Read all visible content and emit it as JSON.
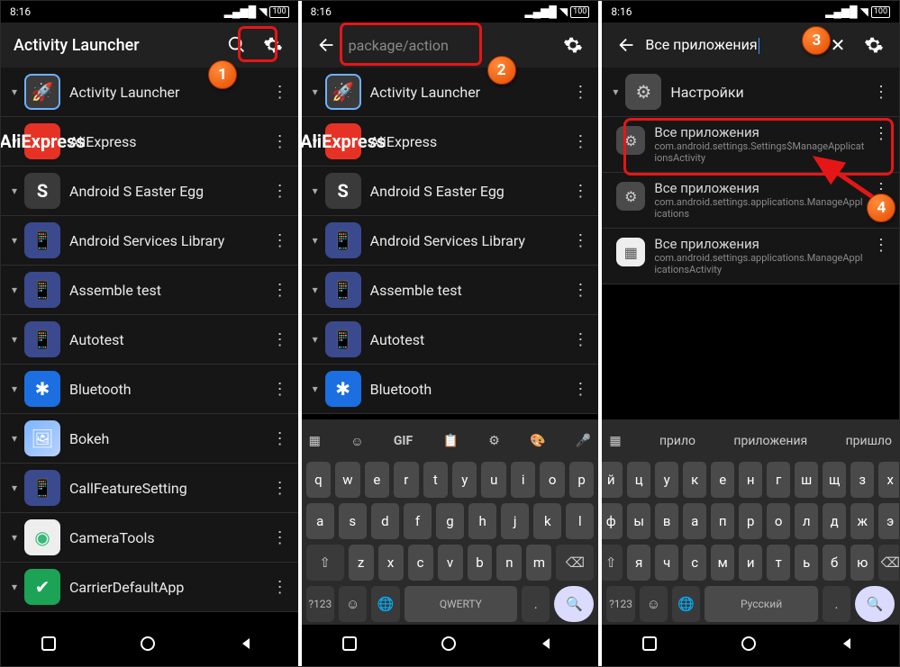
{
  "status": {
    "time": "8:16",
    "battery": "100"
  },
  "panel1": {
    "title": "Activity Launcher",
    "apps": [
      {
        "label": "Activity Launcher",
        "ic": "ic-rocket",
        "glyph": "🚀"
      },
      {
        "label": "AliExpress",
        "ic": "ic-ali",
        "glyph": "AliExpress"
      },
      {
        "label": "Android S Easter Egg",
        "ic": "ic-s",
        "glyph": "S"
      },
      {
        "label": "Android Services Library",
        "ic": "ic-and",
        "glyph": "📱"
      },
      {
        "label": "Assemble test",
        "ic": "ic-and",
        "glyph": "📱"
      },
      {
        "label": "Autotest",
        "ic": "ic-and",
        "glyph": "📱"
      },
      {
        "label": "Bluetooth",
        "ic": "ic-bt",
        "glyph": "✱"
      },
      {
        "label": "Bokeh",
        "ic": "ic-bokeh",
        "glyph": "🖼"
      },
      {
        "label": "CallFeatureSetting",
        "ic": "ic-and",
        "glyph": "📱"
      },
      {
        "label": "CameraTools",
        "ic": "ic-cam",
        "glyph": "◉"
      },
      {
        "label": "CarrierDefaultApp",
        "ic": "ic-car",
        "glyph": "✔"
      }
    ]
  },
  "panel2": {
    "placeholder": "package/action",
    "apps": [
      {
        "label": "Activity Launcher",
        "ic": "ic-rocket",
        "glyph": "🚀"
      },
      {
        "label": "AliExpress",
        "ic": "ic-ali",
        "glyph": "AliExpress"
      },
      {
        "label": "Android S Easter Egg",
        "ic": "ic-s",
        "glyph": "S"
      },
      {
        "label": "Android Services Library",
        "ic": "ic-and",
        "glyph": "📱"
      },
      {
        "label": "Assemble test",
        "ic": "ic-and",
        "glyph": "📱"
      },
      {
        "label": "Autotest",
        "ic": "ic-and",
        "glyph": "📱"
      },
      {
        "label": "Bluetooth",
        "ic": "ic-bt",
        "glyph": "✱"
      }
    ],
    "kbd": {
      "space": "QWERTY",
      "numkey": "?123",
      "rows": [
        [
          "q",
          "w",
          "e",
          "r",
          "t",
          "y",
          "u",
          "i",
          "o",
          "p"
        ],
        [
          "a",
          "s",
          "d",
          "f",
          "g",
          "h",
          "j",
          "k",
          "l"
        ],
        [
          "z",
          "x",
          "c",
          "v",
          "b",
          "n",
          "m"
        ]
      ]
    }
  },
  "panel3": {
    "searchvalue": "Все приложения",
    "group": "Настройки",
    "results": [
      {
        "label": "Все приложения",
        "sub": "com.android.settings.Settings$ManageApplicationsActivity",
        "ic": "ic-gear",
        "glyph": "⚙"
      },
      {
        "label": "Все приложения",
        "sub": "com.android.settings.applications.ManageApplications",
        "ic": "ic-gear",
        "glyph": "⚙"
      },
      {
        "label": "Все приложения",
        "sub": "com.android.settings.applications.ManageApplicationsActivity",
        "ic": "ic-grid",
        "glyph": "▦"
      }
    ],
    "kbd": {
      "space": "Русский",
      "numkey": "?123",
      "sugg": [
        "прило",
        "приложения",
        "пришло"
      ],
      "rows": [
        [
          "й",
          "ц",
          "у",
          "к",
          "е",
          "н",
          "г",
          "ш",
          "щ",
          "з",
          "х"
        ],
        [
          "ф",
          "ы",
          "в",
          "а",
          "п",
          "р",
          "о",
          "л",
          "д",
          "ж",
          "э"
        ],
        [
          "я",
          "ч",
          "с",
          "м",
          "и",
          "т",
          "ь",
          "б",
          "ю"
        ]
      ]
    }
  },
  "callouts": {
    "1": "1",
    "2": "2",
    "3": "3",
    "4": "4"
  }
}
